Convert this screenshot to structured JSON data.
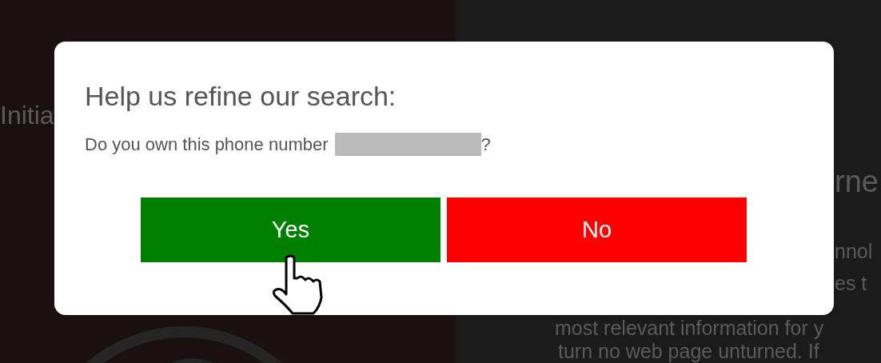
{
  "background": {
    "left_text": "Initia",
    "right_heading": "rne",
    "right_lines": [
      "nnol",
      "es t",
      "most relevant information for y",
      "turn no web page unturned. If"
    ]
  },
  "dialog": {
    "title": "Help us refine our search:",
    "question": "Do you own this phone number",
    "question_end": "?",
    "buttons": [
      {
        "label": "Yes",
        "color": "#008000"
      },
      {
        "label": "No",
        "color": "#ff0000"
      }
    ]
  }
}
